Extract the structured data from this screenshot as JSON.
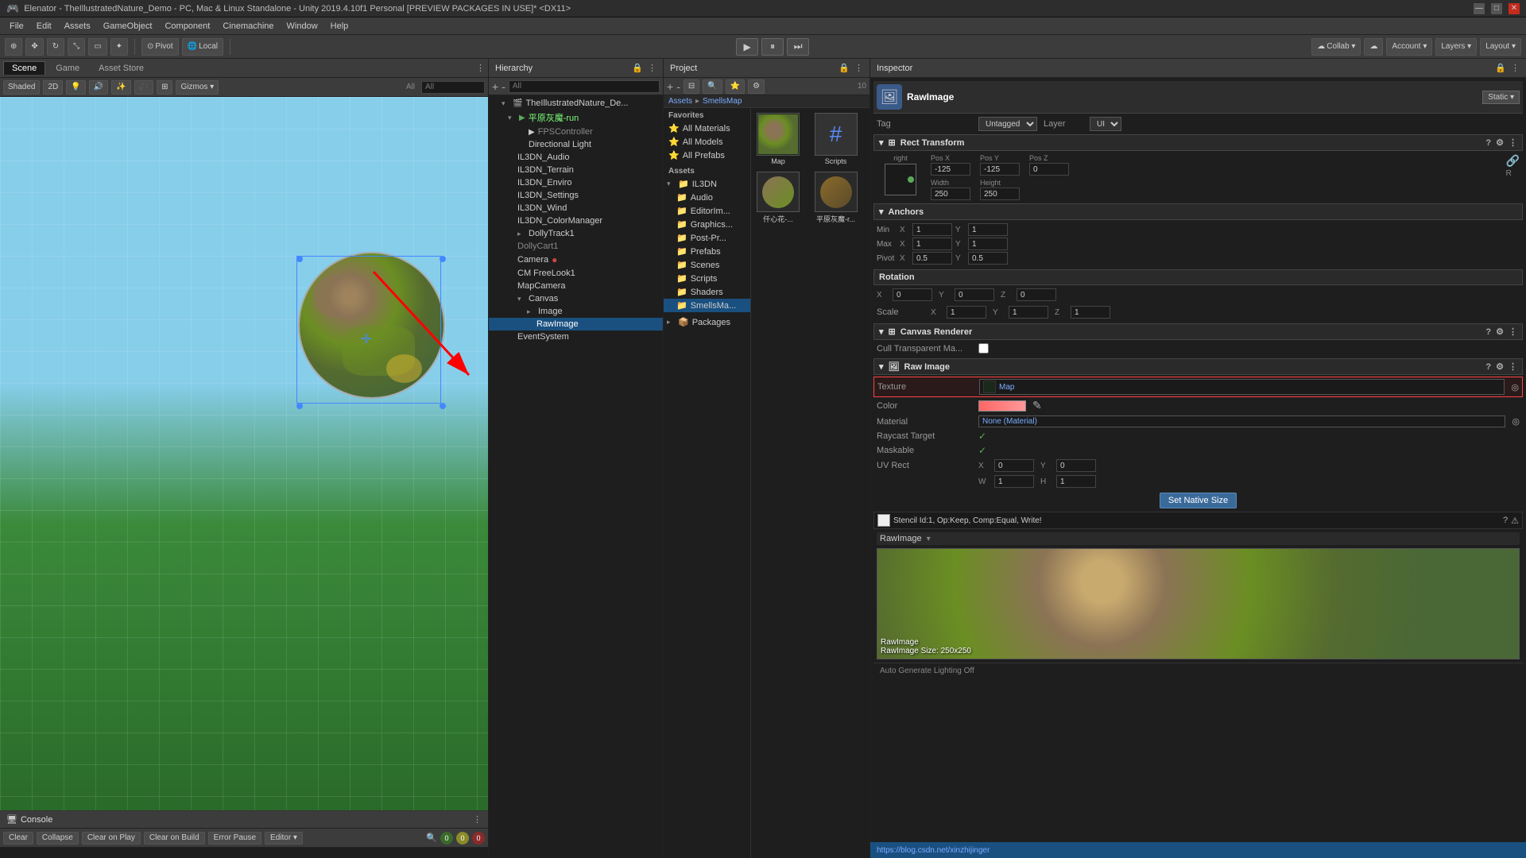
{
  "titlebar": {
    "title": "Elenator - TheIllustratedNature_Demo - PC, Mac & Linux Standalone - Unity 2019.4.10f1 Personal [PREVIEW PACKAGES IN USE]* <DX11>"
  },
  "menu": {
    "items": [
      "File",
      "Edit",
      "Assets",
      "GameObject",
      "Component",
      "Cinemachine",
      "Window",
      "Help"
    ]
  },
  "toolbar": {
    "pivot_label": "Pivot",
    "local_label": "Local",
    "collab_label": "Collab ▾",
    "account_label": "Account ▾",
    "layers_label": "Layers ▾",
    "layout_label": "Layout ▾"
  },
  "scene": {
    "tabs": [
      "Scene",
      "Game",
      "Asset Store"
    ],
    "active_tab": "Scene",
    "shaded_label": "Shaded",
    "two_d_label": "2D",
    "gizmos_label": "Gizmos ▾",
    "all_label": "All"
  },
  "hierarchy": {
    "title": "Hierarchy",
    "search_placeholder": "All",
    "items": [
      {
        "id": "root",
        "label": "TheIllustratedNature_De...",
        "indent": 0,
        "expanded": true,
        "icon": "▸"
      },
      {
        "id": "fps",
        "label": "平原灰魔-run",
        "indent": 1,
        "expanded": true,
        "icon": "▸"
      },
      {
        "id": "fps2",
        "label": "FPSController",
        "indent": 2,
        "icon": "",
        "disabled": true
      },
      {
        "id": "dirlight",
        "label": "Directional Light",
        "indent": 2,
        "icon": ""
      },
      {
        "id": "audio",
        "label": "IL3DN_Audio",
        "indent": 2,
        "icon": ""
      },
      {
        "id": "terrain",
        "label": "IL3DN_Terrain",
        "indent": 2,
        "icon": ""
      },
      {
        "id": "enviro",
        "label": "IL3DN_Enviro",
        "indent": 2,
        "icon": ""
      },
      {
        "id": "settings",
        "label": "IL3DN_Settings",
        "indent": 2,
        "icon": ""
      },
      {
        "id": "wind",
        "label": "IL3DN_Wind",
        "indent": 2,
        "icon": ""
      },
      {
        "id": "colormgr",
        "label": "IL3DN_ColorManager",
        "indent": 2,
        "icon": ""
      },
      {
        "id": "dolly1",
        "label": "DollyTrack1",
        "indent": 2,
        "icon": "▸"
      },
      {
        "id": "dolly2",
        "label": "DollyCart1",
        "indent": 2,
        "icon": "",
        "disabled": true
      },
      {
        "id": "camera",
        "label": "Camera",
        "indent": 2,
        "icon": "",
        "has_dot": true
      },
      {
        "id": "freelook",
        "label": "CM FreeLook1",
        "indent": 2,
        "icon": ""
      },
      {
        "id": "mapcam",
        "label": "MapCamera",
        "indent": 2,
        "icon": ""
      },
      {
        "id": "canvas",
        "label": "Canvas",
        "indent": 2,
        "icon": "▸",
        "expanded": true
      },
      {
        "id": "image",
        "label": "Image",
        "indent": 3,
        "icon": "▸"
      },
      {
        "id": "rawimage",
        "label": "RawImage",
        "indent": 4,
        "icon": "",
        "selected": true
      },
      {
        "id": "eventsys",
        "label": "EventSystem",
        "indent": 2,
        "icon": ""
      }
    ]
  },
  "project": {
    "title": "Project",
    "favorites": {
      "title": "Favorites",
      "items": [
        "All Materials",
        "All Models",
        "All Prefabs"
      ]
    },
    "assets": {
      "title": "Assets",
      "folders": [
        "IL3DN"
      ],
      "subfolders": [
        "Audio",
        "EditorIm...",
        "Graphics...",
        "Post-Pr...",
        "Prefabs",
        "Scenes",
        "Scripts",
        "Shaders",
        "Scenes",
        "SmellsMa..."
      ]
    },
    "packages": {
      "title": "Packages"
    },
    "breadcrumb": "Assets > SmellsMap",
    "thumbnails": [
      {
        "id": "map",
        "label": "Map",
        "type": "image"
      },
      {
        "id": "scripts",
        "label": "Scripts",
        "type": "folder"
      }
    ],
    "second_row": [
      {
        "id": "kai",
        "label": "仟心花-...",
        "type": "3d"
      },
      {
        "id": "demon",
        "label": "平原灰魔-r...",
        "type": "3d"
      }
    ]
  },
  "inspector": {
    "title": "Inspector",
    "component_name": "RawImage",
    "static_label": "Static ▾",
    "tag_label": "Tag",
    "tag_value": "Untagged",
    "layer_label": "Layer",
    "layer_value": "UI",
    "rect_transform": {
      "title": "Rect Transform",
      "anchor_preset": "right",
      "pos_x_label": "Pos X",
      "pos_x_value": "-125",
      "pos_y_label": "Pos Y",
      "pos_y_value": "-125",
      "pos_z_label": "Pos Z",
      "pos_z_value": "0",
      "width_label": "Width",
      "width_value": "250",
      "height_label": "Height",
      "height_value": "250"
    },
    "anchors": {
      "title": "Anchors",
      "min_label": "Min",
      "min_x": "1",
      "min_y": "1",
      "max_label": "Max",
      "max_x": "1",
      "max_y": "1",
      "pivot_label": "Pivot",
      "pivot_x": "0.5",
      "pivot_y": "0.5"
    },
    "rotation": {
      "title": "Rotation",
      "x": "0",
      "y": "0",
      "z": "0"
    },
    "scale": {
      "title": "Scale",
      "x": "1",
      "y": "1",
      "z": "1"
    },
    "canvas_renderer": {
      "title": "Canvas Renderer",
      "cull_label": "Cull Transparent Ma..."
    },
    "raw_image": {
      "title": "Raw Image",
      "texture_label": "Texture",
      "texture_value": "Map",
      "color_label": "Color",
      "material_label": "Material",
      "material_value": "None (Material)",
      "raycast_label": "Raycast Target",
      "maskable_label": "Maskable",
      "uv_rect_label": "UV Rect",
      "uv_x": "0",
      "uv_y": "0",
      "uv_w": "1",
      "uv_h": "1"
    },
    "native_size_btn": "Set Native Size",
    "stencil_label": "Stencil Id:1, Op:Keep, Comp:Equal, Write!",
    "rawimage_preview_label": "RawImage",
    "rawimage_preview_size": "RawImage\nRawImage Size: 250x250",
    "auto_generate": "Auto Generate Lighting Off",
    "bottom_url": "https://blog.csdn.net/xinzhijinger"
  },
  "console": {
    "title": "Console",
    "clear_label": "Clear",
    "collapse_label": "Collapse",
    "clear_on_play_label": "Clear on Play",
    "clear_on_build_label": "Clear on Build",
    "error_pause_label": "Error Pause",
    "editor_label": "Editor ▾",
    "info_count": "0",
    "warn_count": "0",
    "error_count": "0"
  },
  "colors": {
    "accent_blue": "#1a5080",
    "bg_dark": "#1e1e1e",
    "bg_medium": "#2d2d2d",
    "bg_toolbar": "#3c3c3c",
    "border": "#444",
    "selected": "#1a5080",
    "red_arrow": "#ff0000"
  }
}
